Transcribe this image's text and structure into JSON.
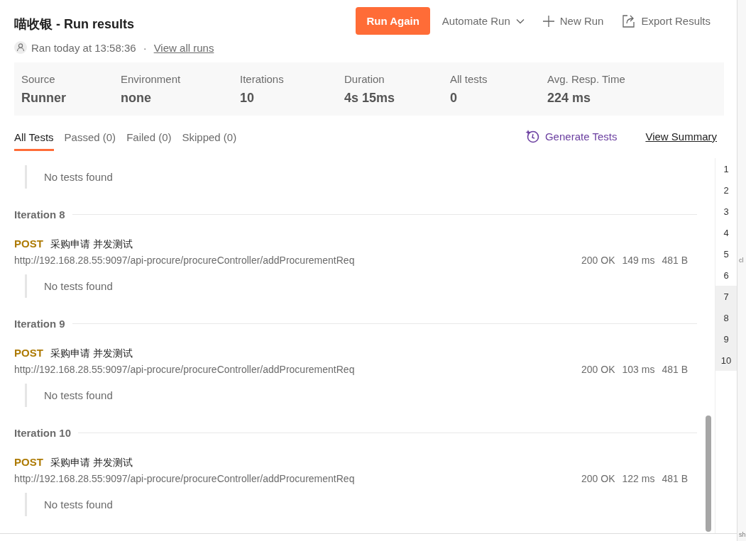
{
  "header": {
    "title": "喵收银 - Run results",
    "ran": "Ran today at 13:58:36",
    "separator": "·",
    "view_all_runs": "View all runs",
    "actions": {
      "run_again": "Run Again",
      "automate_run": "Automate Run",
      "new_run": "New Run",
      "export_results": "Export Results"
    }
  },
  "stats": [
    {
      "label": "Source",
      "value": "Runner"
    },
    {
      "label": "Environment",
      "value": "none"
    },
    {
      "label": "Iterations",
      "value": "10"
    },
    {
      "label": "Duration",
      "value": "4s 15ms"
    },
    {
      "label": "All tests",
      "value": "0"
    },
    {
      "label": "Avg. Resp. Time",
      "value": "224 ms"
    }
  ],
  "tabs": [
    {
      "label": "All Tests",
      "selected": true
    },
    {
      "label": "Passed (0)",
      "selected": false
    },
    {
      "label": "Failed (0)",
      "selected": false
    },
    {
      "label": "Skipped (0)",
      "selected": false
    }
  ],
  "generate_tests": "Generate Tests",
  "view_summary": "View Summary",
  "leading_tests": "No tests found",
  "iterations": [
    {
      "title": "Iteration 8",
      "requests": [
        {
          "method": "POST",
          "name": "采购申请 并发测试",
          "url": "http://192.168.28.55:9097/api-procure/procureController/addProcurementReq",
          "status": "200 OK",
          "time": "149 ms",
          "size": "481 B",
          "tests": "No tests found"
        }
      ]
    },
    {
      "title": "Iteration 9",
      "requests": [
        {
          "method": "POST",
          "name": "采购申请 并发测试",
          "url": "http://192.168.28.55:9097/api-procure/procureController/addProcurementReq",
          "status": "200 OK",
          "time": "103 ms",
          "size": "481 B",
          "tests": "No tests found"
        }
      ]
    },
    {
      "title": "Iteration 10",
      "requests": [
        {
          "method": "POST",
          "name": "采购申请 并发测试",
          "url": "http://192.168.28.55:9097/api-procure/procureController/addProcurementReq",
          "status": "200 OK",
          "time": "122 ms",
          "size": "481 B",
          "tests": "No tests found"
        }
      ]
    }
  ],
  "iteration_nav": [
    {
      "label": "1",
      "in_view": false
    },
    {
      "label": "2",
      "in_view": false
    },
    {
      "label": "3",
      "in_view": false
    },
    {
      "label": "4",
      "in_view": false
    },
    {
      "label": "5",
      "in_view": false
    },
    {
      "label": "6",
      "in_view": false
    },
    {
      "label": "7",
      "in_view": true
    },
    {
      "label": "8",
      "in_view": true
    },
    {
      "label": "9",
      "in_view": true
    },
    {
      "label": "10",
      "in_view": true
    }
  ],
  "side_pane": [
    "cl",
    "sh"
  ]
}
